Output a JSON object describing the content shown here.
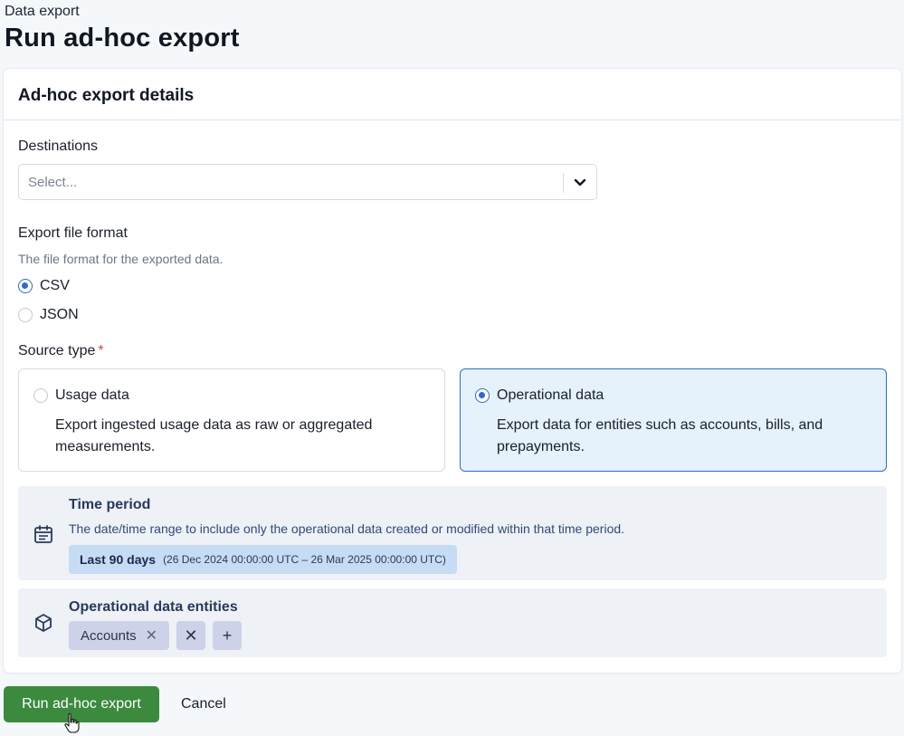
{
  "header": {
    "breadcrumb": "Data export",
    "title": "Run ad-hoc export"
  },
  "card": {
    "title": "Ad-hoc export details"
  },
  "destinations": {
    "label": "Destinations",
    "placeholder": "Select...",
    "chevron_icon": "chevron-down-icon"
  },
  "file_format": {
    "label": "Export file format",
    "hint": "The file format for the exported data.",
    "options": [
      {
        "label": "CSV",
        "selected": true
      },
      {
        "label": "JSON",
        "selected": false
      }
    ]
  },
  "source_type": {
    "label": "Source type",
    "required_mark": "*",
    "options": [
      {
        "title": "Usage data",
        "description": "Export ingested usage data as raw or aggregated measurements.",
        "selected": false
      },
      {
        "title": "Operational data",
        "description": "Export data for entities such as accounts, bills, and prepayments.",
        "selected": true
      }
    ]
  },
  "time_period": {
    "icon": "calendar-icon",
    "title": "Time period",
    "description": "The date/time range to include only the operational data created or modified within that time period.",
    "value": "Last 90 days",
    "range": "(26 Dec 2024 00:00:00 UTC – 26 Mar 2025 00:00:00 UTC)"
  },
  "entities": {
    "icon": "cube-icon",
    "title": "Operational data entities",
    "chips": [
      {
        "label": "Accounts",
        "remove_glyph": "✕"
      }
    ],
    "clear_glyph": "✕",
    "add_glyph": "+"
  },
  "actions": {
    "run_label": "Run ad-hoc export",
    "cancel_label": "Cancel"
  },
  "colors": {
    "primary_button": "#3b8a3e",
    "selected_border": "#2f6cc7",
    "selected_background": "#e5f1fb"
  }
}
